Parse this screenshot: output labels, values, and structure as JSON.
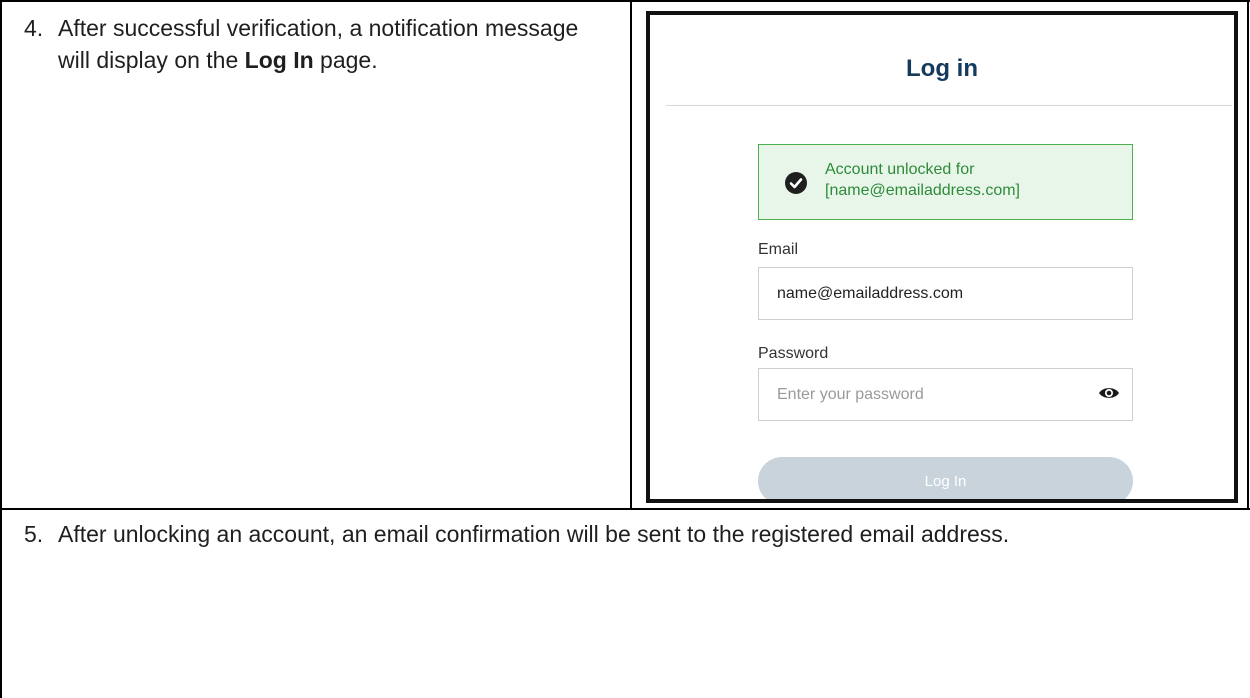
{
  "steps": [
    {
      "number": "4.",
      "text_before": "After successful verification, a notification message will display on the ",
      "bold": "Log In",
      "text_after": " page."
    },
    {
      "number": "5.",
      "text": "After unlocking an account, an email confirmation will be sent to the registered email address."
    }
  ],
  "screenshot": {
    "title": "Log in",
    "alert": {
      "line1": "Account unlocked for",
      "line2": "[name@emailaddress.com]",
      "icon": "check-circle-icon",
      "color": "#4caf50"
    },
    "email_label": "Email",
    "email_value": "name@emailaddress.com",
    "password_label": "Password",
    "password_placeholder": "Enter your password",
    "eye_icon": "eye-icon",
    "login_button": "Log In",
    "title_color": "#143a5e"
  }
}
